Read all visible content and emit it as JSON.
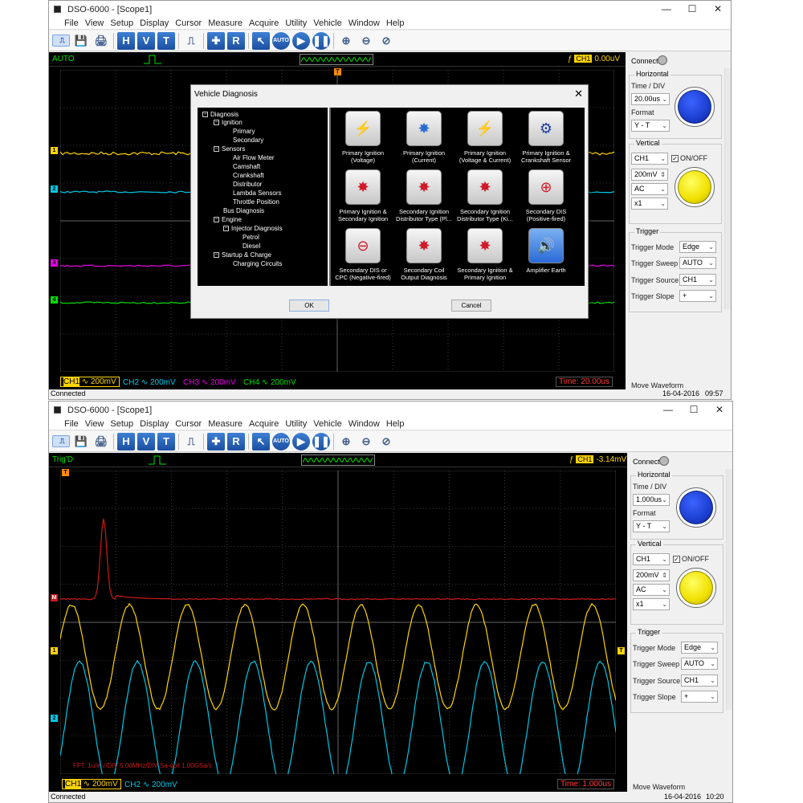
{
  "top": {
    "window_title": "DSO-6000 - [Scope1]",
    "window_controls": [
      "—",
      "☐",
      "✕"
    ],
    "menu": [
      "File",
      "View",
      "Setup",
      "Display",
      "Cursor",
      "Measure",
      "Acquire",
      "Utility",
      "Vehicle",
      "Window",
      "Help"
    ],
    "acq_state": "AUTO",
    "trigger_readout": "0.00uV",
    "trigger_channel": "CH1",
    "channel_labels": [
      {
        "name": "CH1",
        "value": "∿ 200mV",
        "color": "#ffd400"
      },
      {
        "name": "CH2",
        "value": "∿ 200mV",
        "color": "#00c8e6"
      },
      {
        "name": "CH3",
        "value": "∿ 200mV",
        "color": "#e600e6"
      },
      {
        "name": "CH4",
        "value": "∿ 200mV",
        "color": "#00dd00"
      }
    ],
    "time_label": "Time: 20.00us",
    "status_left": "Connected",
    "status_right": "16-04-2016",
    "status_time": "09:57",
    "connect_label": "Connect:",
    "panel": {
      "horizontal": "Horizontal",
      "time_div_label": "Time / DIV",
      "time_div": "20.00us",
      "format_label": "Format",
      "format": "Y - T",
      "vertical": "Vertical",
      "channel": "CH1",
      "onoff": "ON/OFF",
      "volts": "200mV",
      "coupling": "AC",
      "probe": "x1",
      "trigger": "Trigger",
      "trigger_mode_label": "Trigger Mode",
      "trigger_mode": "Edge",
      "trigger_sweep_label": "Trigger Sweep",
      "trigger_sweep": "AUTO",
      "trigger_source_label": "Trigger Source",
      "trigger_source": "CH1",
      "trigger_slope_label": "Trigger Slope",
      "trigger_slope": "+",
      "move_waveform": "Move Waveform"
    },
    "dialog": {
      "title": "Vehicle Diagnosis",
      "close": "✕",
      "tree": [
        "Diagnosis",
        "Ignition",
        "Primary",
        "Secondary",
        "Sensors",
        "Air Flow Meter",
        "Camshaft",
        "Crankshaft",
        "Distributor",
        "Lambda Sensors",
        "Throttle Position",
        "Bus Diagnosis",
        "Engine",
        "Injector Diagnosis",
        "Petrol",
        "Diesel",
        "Startup & Charge",
        "Charging Circuits"
      ],
      "tiles": [
        [
          "Primary Ignition",
          "(Voltage)"
        ],
        [
          "Primary Ignition",
          "(Current)"
        ],
        [
          "Primary Ignition",
          "(Voltage & Current)"
        ],
        [
          "Primary Ignition &",
          "Crankshaft Sensor"
        ],
        [
          "Primary Ignition &",
          "Secondary Ignition"
        ],
        [
          "Secondary Ignition",
          "Distributor Type (Pl..."
        ],
        [
          "Secondary Ignition",
          "Distributor Type (Ki..."
        ],
        [
          "Secondary DIS",
          "(Positive-fired)"
        ],
        [
          "Secondary DIS or",
          "CPC (Negative-fired)"
        ],
        [
          "Secondary Coil",
          "Output Diagnosis"
        ],
        [
          "Secondary Ignition &",
          "Primary Ignition"
        ],
        [
          "Amplifier Earth",
          ""
        ]
      ],
      "ok": "OK",
      "cancel": "Cancel"
    }
  },
  "bottom": {
    "window_title": "DSO-6000 - [Scope1]",
    "window_controls": [
      "—",
      "☐",
      "✕"
    ],
    "menu": [
      "File",
      "View",
      "Setup",
      "Display",
      "Cursor",
      "Measure",
      "Acquire",
      "Utility",
      "Vehicle",
      "Window",
      "Help"
    ],
    "acq_state": "Trig'D",
    "trigger_readout": "-3.14mV",
    "trigger_channel": "CH1",
    "channel_labels": [
      {
        "name": "CH1",
        "value": "∿ 200mV",
        "color": "#ffd400"
      },
      {
        "name": "CH2",
        "value": "∿ 200mV",
        "color": "#00c8e6"
      }
    ],
    "fft_text": "FFT: 1u/e √/DIV   5.00MHz/DIV   Sa-ooll   1.00GSa/s",
    "time_label": "Time: 1.000us",
    "status_left": "Connected",
    "status_right": "16-04-2016",
    "status_time": "10:20",
    "connect_label": "Connect:",
    "panel": {
      "horizontal": "Horizontal",
      "time_div_label": "Time / DIV",
      "time_div": "1.000us",
      "format_label": "Format",
      "format": "Y - T",
      "vertical": "Vertical",
      "channel": "CH1",
      "onoff": "ON/OFF",
      "volts": "200mV",
      "coupling": "AC",
      "probe": "x1",
      "trigger": "Trigger",
      "trigger_mode_label": "Trigger Mode",
      "trigger_mode": "Edge",
      "trigger_sweep_label": "Trigger Sweep",
      "trigger_sweep": "AUTO",
      "trigger_source_label": "Trigger Source",
      "trigger_source": "CH1",
      "trigger_slope_label": "Trigger Slope",
      "trigger_slope": "+",
      "move_waveform": "Move Waveform"
    }
  },
  "colors": {
    "ch1": "#ffd400",
    "ch2": "#00c8e6",
    "ch3": "#e600e6",
    "ch4": "#00dd00",
    "fft": "#cc1a1a",
    "knob_blue": "#1c3fd0",
    "knob_yellow": "#f0e000"
  },
  "toolbar_icons": [
    "open-icon",
    "save-icon",
    "print-icon",
    "H",
    "V",
    "T",
    "measure-icon",
    "measure-all-icon",
    "cursor-icon",
    "R",
    "pointer-icon",
    "auto-icon",
    "run-icon",
    "pause-icon",
    "zoom-in-icon",
    "zoom-out-icon",
    "zoom-reset-icon"
  ]
}
